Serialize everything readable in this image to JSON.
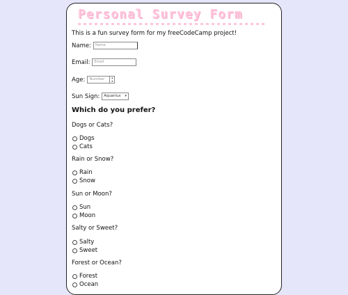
{
  "title": "Personal Survey Form",
  "intro": "This is a fun survey form for my freeCodeCamp project!",
  "fields": {
    "name": {
      "label": "Name:",
      "placeholder": "Name"
    },
    "email": {
      "label": "Email:",
      "placeholder": "Email"
    },
    "age": {
      "label": "Age:",
      "placeholder": "Number"
    },
    "sun_sign": {
      "label": "Sun Sign:",
      "selected": "Aquarius"
    }
  },
  "prefer_heading": "Which do you prefer?",
  "questions": [
    {
      "question": "Dogs or Cats?",
      "options": [
        "Dogs",
        "Cats"
      ]
    },
    {
      "question": "Rain or Snow?",
      "options": [
        "Rain",
        "Snow"
      ]
    },
    {
      "question": "Sun or Moon?",
      "options": [
        "Sun",
        "Moon"
      ]
    },
    {
      "question": "Salty or Sweet?",
      "options": [
        "Salty",
        "Sweet"
      ]
    },
    {
      "question": "Forest or Ocean?",
      "options": [
        "Forest",
        "Ocean"
      ]
    }
  ],
  "colors": {
    "background": "#e6e6fa",
    "title": "#ffc6dd",
    "card": "#ffffff"
  }
}
